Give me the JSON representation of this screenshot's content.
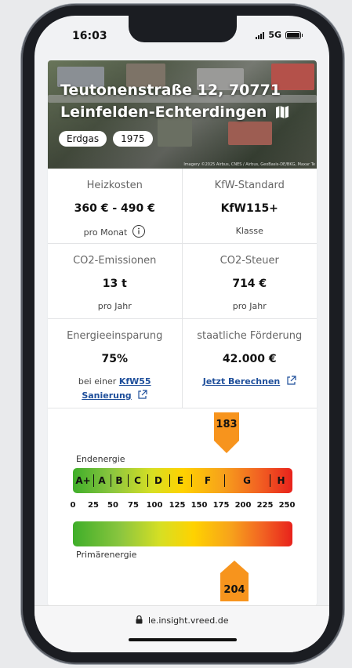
{
  "status_bar": {
    "time": "16:03",
    "network": "5G"
  },
  "hero": {
    "address_line1": "Teutonenstraße 12, 70771",
    "address_line2": "Leinfelden-Echterdingen",
    "chips": [
      "Erdgas",
      "1975"
    ],
    "attribution": "Imagery ©2025 Airbus, CNES / Airbus, GeoBasis-DE/BKG, Maxar Te"
  },
  "metrics": {
    "heizkosten": {
      "label": "Heizkosten",
      "value": "360 € - 490 €",
      "sub": "pro Monat"
    },
    "kfw": {
      "label": "KfW-Standard",
      "value": "KfW115+",
      "sub": "Klasse"
    },
    "co2_emissionen": {
      "label": "CO2-Emissionen",
      "value": "13 t",
      "sub": "pro Jahr"
    },
    "co2_steuer": {
      "label": "CO2-Steuer",
      "value": "714 €",
      "sub": "pro Jahr"
    },
    "energieeinsparung": {
      "label": "Energieeinsparung",
      "value": "75%",
      "sub_prefix": "bei einer",
      "link1": "KfW55",
      "link2": "Sanierung"
    },
    "foerderung": {
      "label": "staatliche Förderung",
      "value": "42.000 €",
      "link": "Jetzt Berechnen"
    }
  },
  "energy_scale": {
    "endenergie_label": "Endenergie",
    "endenergie_value": "183",
    "primaerenergie_label": "Primärenergie",
    "primaerenergie_value": "204",
    "classes": [
      "A+",
      "A",
      "B",
      "C",
      "D",
      "E",
      "F",
      "G",
      "H"
    ],
    "ticks": [
      "0",
      "25",
      "50",
      "75",
      "100",
      "125",
      "150",
      "175",
      "200",
      "225",
      "250"
    ],
    "colors": {
      "start": "#3fae2a",
      "mid": "#ffd200",
      "end": "#e8221c",
      "marker": "#f7941d"
    }
  },
  "browser": {
    "url": "le.insight.vreed.de"
  }
}
